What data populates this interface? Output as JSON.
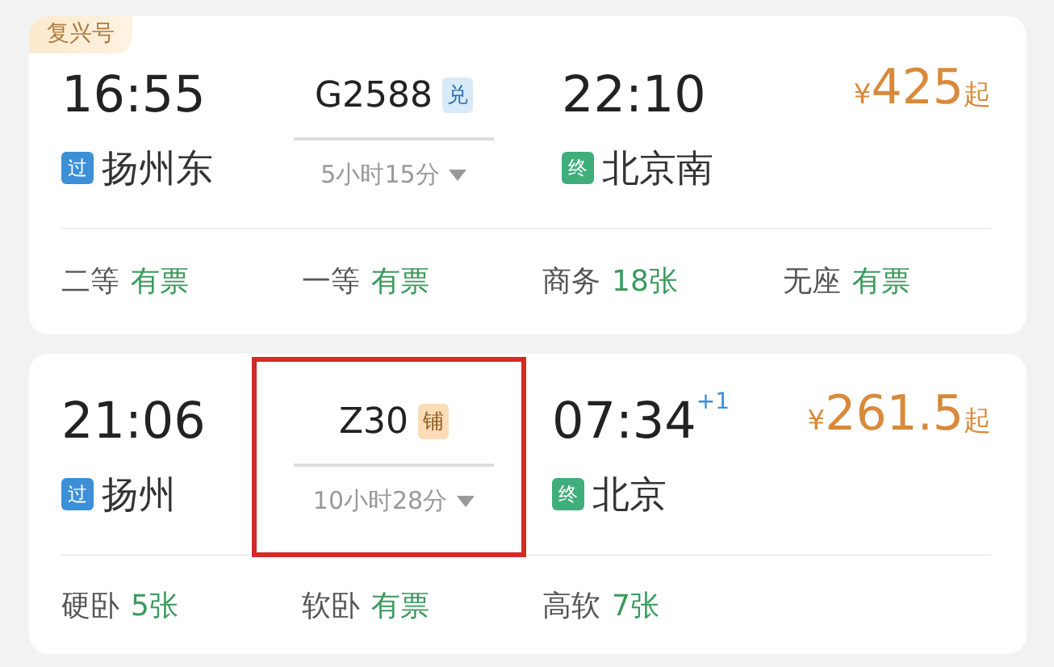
{
  "trains": [
    {
      "badge": "复兴号",
      "depart_time": "16:55",
      "train_no": "G2588",
      "train_tag": {
        "text": "兑",
        "kind": "exchange"
      },
      "duration": "5小时15分",
      "arrive_time": "22:10",
      "from_tag": "过",
      "from_station": "扬州东",
      "to_tag": "终",
      "to_station": "北京南",
      "currency": "¥",
      "price": "425",
      "price_suffix": "起",
      "highlighted": false,
      "seats": [
        {
          "class": "二等",
          "availability": "有票"
        },
        {
          "class": "一等",
          "availability": "有票"
        },
        {
          "class": "商务",
          "availability": "18张"
        },
        {
          "class": "无座",
          "availability": "有票"
        }
      ]
    },
    {
      "depart_time": "21:06",
      "train_no": "Z30",
      "train_tag": {
        "text": "铺",
        "kind": "sleeper"
      },
      "duration": "10小时28分",
      "arrive_time": "07:34",
      "day_offset": "+1",
      "from_tag": "过",
      "from_station": "扬州",
      "to_tag": "终",
      "to_station": "北京",
      "currency": "¥",
      "price": "261.5",
      "price_suffix": "起",
      "highlighted": true,
      "seats": [
        {
          "class": "硬卧",
          "availability": "5张"
        },
        {
          "class": "软卧",
          "availability": "有票"
        },
        {
          "class": "高软",
          "availability": "7张"
        }
      ]
    }
  ]
}
